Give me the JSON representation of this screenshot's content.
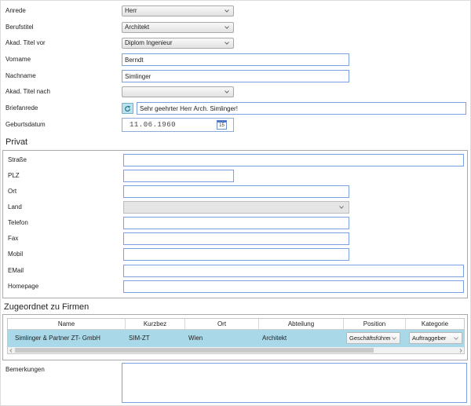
{
  "personal": {
    "anrede": {
      "label": "Anrede",
      "value": "Herr"
    },
    "berufstitel": {
      "label": "Berufstitel",
      "value": "Architekt"
    },
    "titel_vor": {
      "label": "Akad. Titel vor",
      "value": "Diplom Ingenieur"
    },
    "vorname": {
      "label": "Vorname",
      "value": "Berndt"
    },
    "nachname": {
      "label": "Nachname",
      "value": "Simlinger"
    },
    "titel_nach": {
      "label": "Akad. Titel nach",
      "value": ""
    },
    "briefanrede": {
      "label": "Briefanrede",
      "value": "Sehr geehrter Herr Arch. Simlinger!"
    },
    "geburtsdatum": {
      "label": "Geburtsdatum",
      "value": "11.06.1960",
      "calendar_day": "15"
    }
  },
  "privat": {
    "heading": "Privat",
    "strasse": {
      "label": "Straße",
      "value": ""
    },
    "plz": {
      "label": "PLZ",
      "value": ""
    },
    "ort": {
      "label": "Ort",
      "value": ""
    },
    "land": {
      "label": "Land",
      "value": ""
    },
    "telefon": {
      "label": "Telefon",
      "value": ""
    },
    "fax": {
      "label": "Fax",
      "value": ""
    },
    "mobil": {
      "label": "Mobil",
      "value": ""
    },
    "email": {
      "label": "EMail",
      "value": ""
    },
    "homepage": {
      "label": "Homepage",
      "value": ""
    }
  },
  "firmen": {
    "heading": "Zugeordnet zu Firmen",
    "columns": [
      "Name",
      "Kurzbez",
      "Ort",
      "Abteilung",
      "Position",
      "Kategorie"
    ],
    "rows": [
      {
        "name": "Simlinger & Partner ZT- GmbH",
        "kurzbez": "SIM-ZT",
        "ort": "Wien",
        "abteilung": "Architekt",
        "position": "Geschäftsführer",
        "kategorie": "Auftraggeber",
        "selected": true
      }
    ]
  },
  "bemerkungen": {
    "label": "Bemerkungen",
    "value": ""
  },
  "icons": {
    "select_chevron": "chevron-down-icon",
    "briefanrede_button": "refresh-icon",
    "date_picker": "calendar-icon",
    "scroll_left": "chevron-left-icon",
    "scroll_right": "chevron-right-icon"
  },
  "colors": {
    "input_border": "#7b9fe0",
    "selected_row": "#a9d8e8",
    "refresh_button": "#b8e3ee",
    "fieldset_border": "#aaaaaa"
  }
}
